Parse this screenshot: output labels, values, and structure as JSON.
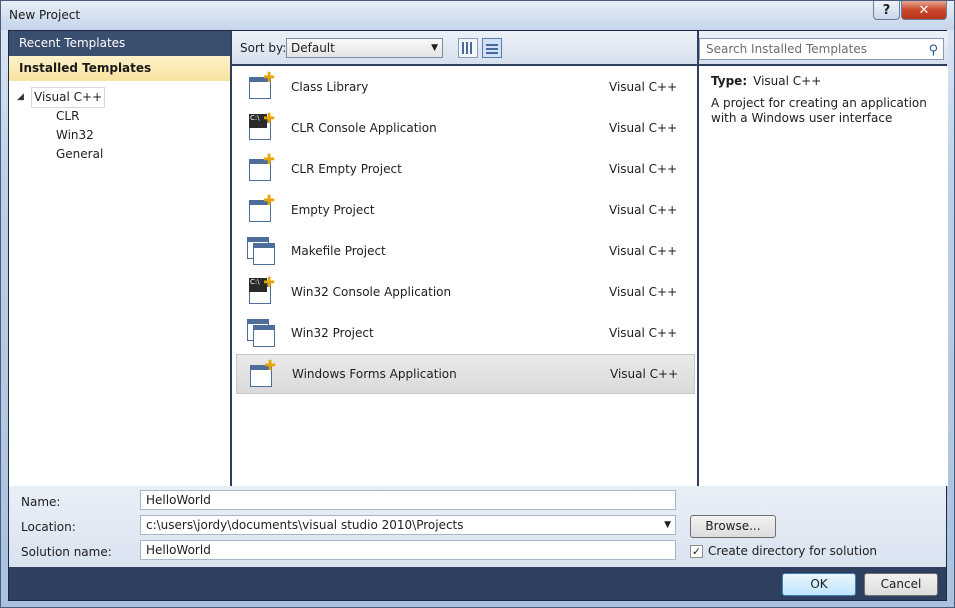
{
  "window": {
    "title": "New Project",
    "help": "?",
    "close": "✕"
  },
  "sidebar": {
    "recent": "Recent Templates",
    "installed": "Installed Templates",
    "tree": {
      "root": "Visual C++",
      "children": [
        "CLR",
        "Win32",
        "General"
      ]
    }
  },
  "toolbar": {
    "sort_label": "Sort by:",
    "sort_value": "Default"
  },
  "search": {
    "placeholder": "Search Installed Templates"
  },
  "templates": [
    {
      "name": "Class Library",
      "lang": "Visual C++",
      "icon": "class-library-icon"
    },
    {
      "name": "CLR Console Application",
      "lang": "Visual C++",
      "icon": "console-app-icon"
    },
    {
      "name": "CLR Empty Project",
      "lang": "Visual C++",
      "icon": "empty-project-icon"
    },
    {
      "name": "Empty Project",
      "lang": "Visual C++",
      "icon": "empty-project-icon"
    },
    {
      "name": "Makefile Project",
      "lang": "Visual C++",
      "icon": "makefile-icon"
    },
    {
      "name": "Win32 Console Application",
      "lang": "Visual C++",
      "icon": "console-app-icon"
    },
    {
      "name": "Win32 Project",
      "lang": "Visual C++",
      "icon": "win32-project-icon"
    },
    {
      "name": "Windows Forms Application",
      "lang": "Visual C++",
      "icon": "forms-app-icon",
      "selected": true
    }
  ],
  "details": {
    "type_label": "Type:",
    "type_value": "Visual C++",
    "description": "A project for creating an application with a Windows user interface"
  },
  "form": {
    "name_label": "Name:",
    "name_value": "HelloWorld",
    "location_label": "Location:",
    "location_value": "c:\\users\\jordy\\documents\\visual studio 2010\\Projects",
    "solution_label": "Solution name:",
    "solution_value": "HelloWorld",
    "browse": "Browse...",
    "create_dir": "Create directory for solution",
    "create_dir_checked": true
  },
  "buttons": {
    "ok": "OK",
    "cancel": "Cancel"
  }
}
